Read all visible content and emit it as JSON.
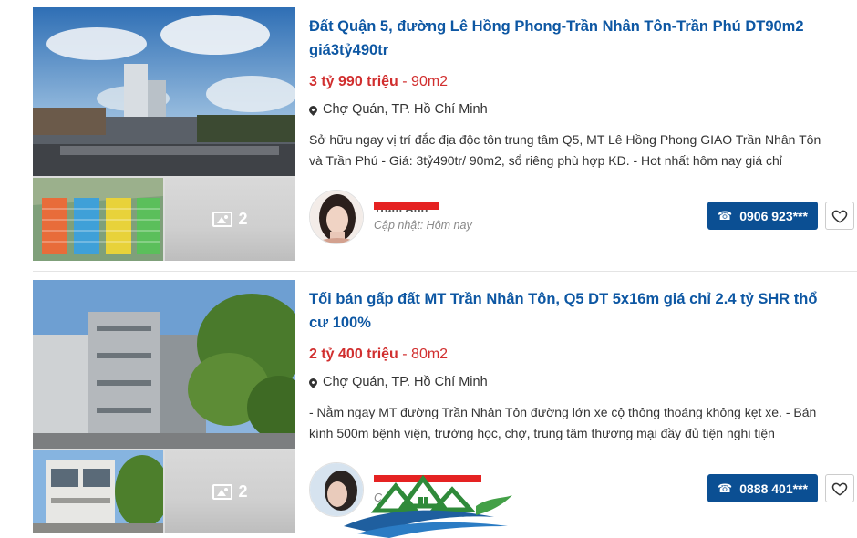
{
  "listings": [
    {
      "title": "Đất Quận 5, đường Lê Hồng Phong-Trần Nhân Tôn-Trần Phú DT90m2 giá3tỷ490tr",
      "price": "3 tỷ 990 triệu",
      "separator": " - ",
      "area": "90m2",
      "location": "Chợ Quán, TP. Hồ Chí Minh",
      "description": "Sở hữu ngay vị trí đắc địa độc tôn trung tâm Q5, MT Lê Hồng Phong GIAO Trần Nhân Tôn và Trần Phú - Giá: 3tỷ490tr/ 90m2, sổ riêng phù hợp KD. - Hot nhất hôm nay giá chỉ",
      "more_photos": "2",
      "agent_name": "Trâm Anh",
      "updated": "Cập nhật: Hôm nay",
      "phone": "0906 923***"
    },
    {
      "title": "Tối bán gấp đất MT Trần Nhân Tôn, Q5 DT 5x16m giá chỉ 2.4 tỷ SHR thổ cư 100%",
      "price": "2 tỷ 400 triệu",
      "separator": " - ",
      "area": "80m2",
      "location": "Chợ Quán, TP. Hồ Chí Minh",
      "description": "- Nằm ngay MT đường Trần Nhân Tôn đường lớn xe cộ thông thoáng không kẹt xe. - Bán kính 500m bệnh viện, trường học, chợ, trung tâm thương mại đầy đủ tiện nghi tiện",
      "more_photos": "2",
      "agent_name": "",
      "updated": "C",
      "phone": "0888 401***"
    }
  ],
  "icons": {
    "location": "map-pin-icon",
    "phone": "phone-icon",
    "favorite": "heart-icon",
    "photos": "image-icon"
  },
  "colors": {
    "title": "#0d57a3",
    "price": "#d12f2f",
    "button": "#0b4f93"
  }
}
